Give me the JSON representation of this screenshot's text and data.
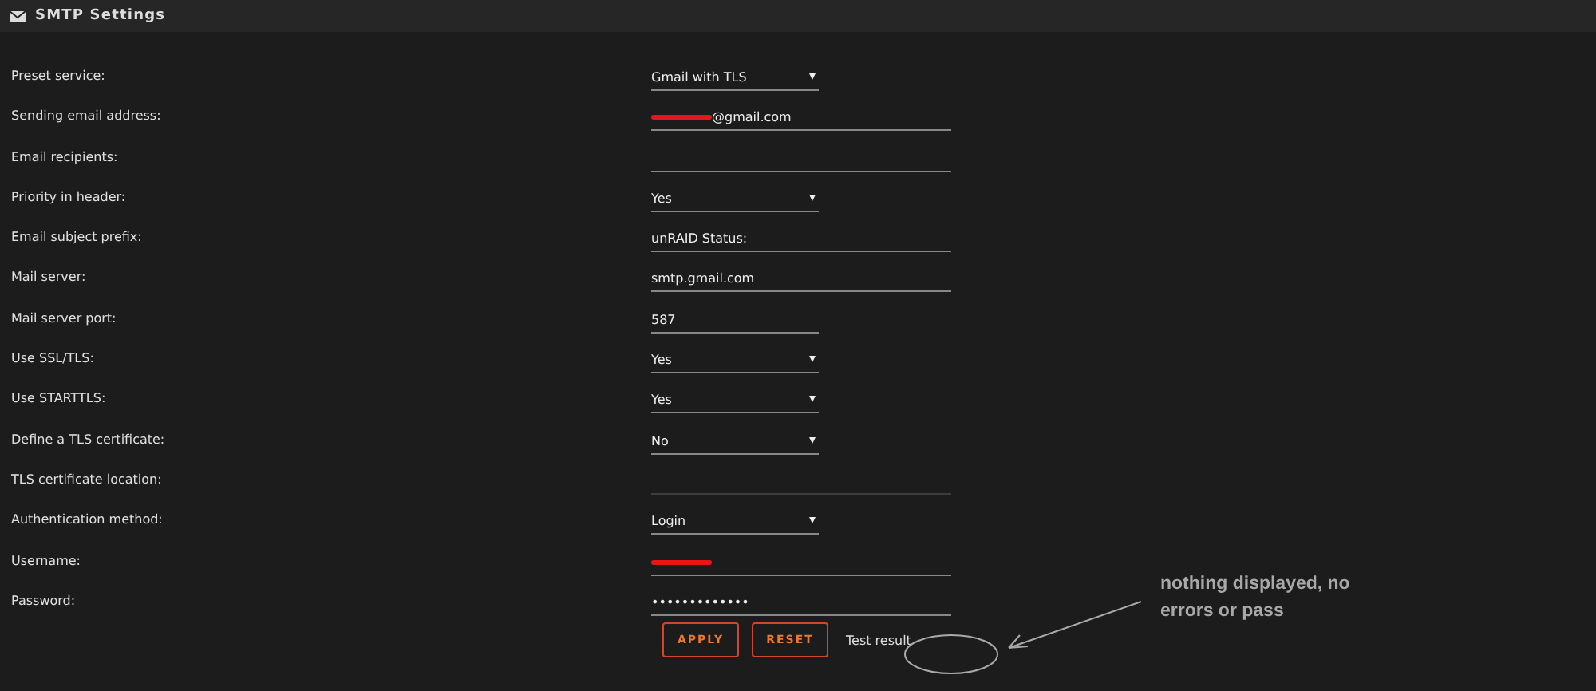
{
  "window": {
    "title": "SMTP Settings"
  },
  "fields": [
    {
      "label": "Preset service:",
      "kind": "select",
      "value": "Gmail with TLS"
    },
    {
      "label": "Sending email address:",
      "kind": "text",
      "value": "@gmail.com",
      "redacted": true
    },
    {
      "label": "Email recipients:",
      "kind": "text"
    },
    {
      "label": "Priority in header:",
      "kind": "select",
      "value": "Yes"
    },
    {
      "label": "Email subject prefix:",
      "kind": "text",
      "value": "unRAID Status:"
    },
    {
      "label": "Mail server:",
      "kind": "text",
      "value": "smtp.gmail.com"
    },
    {
      "label": "Mail server port:",
      "kind": "short",
      "value": "587"
    },
    {
      "label": "Use SSL/TLS:",
      "kind": "select",
      "value": "Yes"
    },
    {
      "label": "Use STARTTLS:",
      "kind": "select",
      "value": "Yes"
    },
    {
      "label": "Define a TLS certificate:",
      "kind": "select",
      "value": "No"
    },
    {
      "label": "TLS certificate location:",
      "kind": "text",
      "disabled": true
    },
    {
      "label": "Authentication method:",
      "kind": "select",
      "value": "Login"
    },
    {
      "label": "Username:",
      "kind": "text",
      "redacted": true
    },
    {
      "label": "Password:",
      "kind": "password",
      "value": "•••••••••••••"
    }
  ],
  "buttons": [
    "APPLY",
    "RESET"
  ],
  "test_result": {
    "label": "Test result"
  },
  "annotation": {
    "text": "nothing displayed, no errors or pass"
  }
}
